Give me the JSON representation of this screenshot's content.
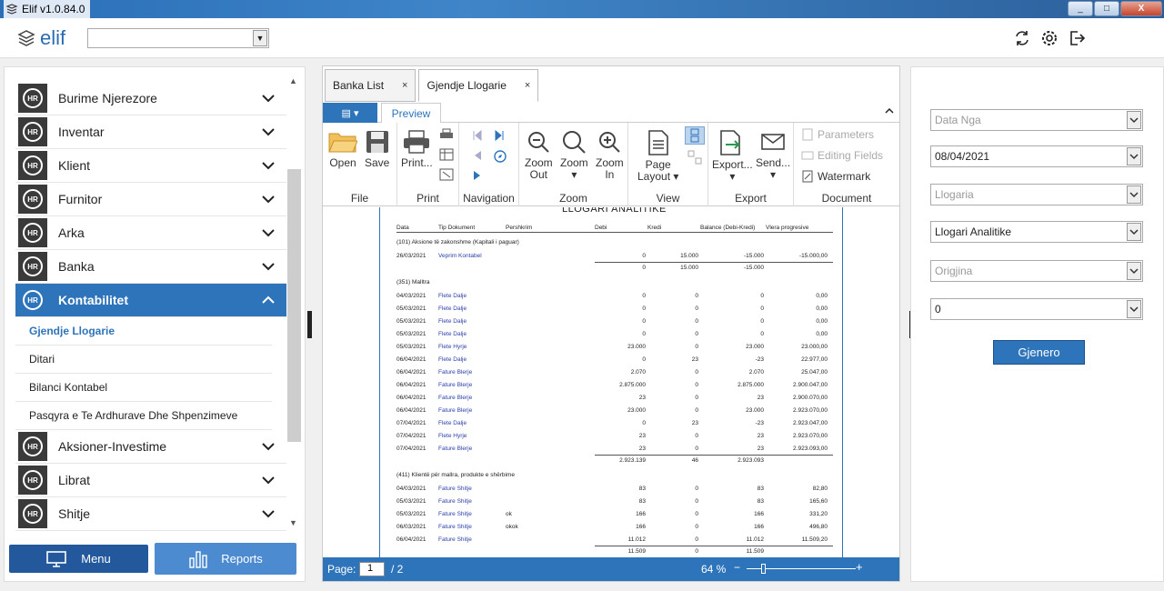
{
  "window": {
    "title": "Elif v1.0.84.0",
    "controls": [
      "_",
      "□",
      "X"
    ]
  },
  "app": {
    "logo_text": "elif",
    "top_combo_value": ""
  },
  "sidebar": {
    "items_before": [
      {
        "label": "Burime Njerezore"
      },
      {
        "label": "Inventar"
      },
      {
        "label": "Klient"
      },
      {
        "label": "Furnitor"
      },
      {
        "label": "Arka"
      },
      {
        "label": "Banka"
      }
    ],
    "active": {
      "label": "Kontabilitet"
    },
    "subitems": [
      {
        "label": "Gjendje Llogarie",
        "selected": true
      },
      {
        "label": "Ditari"
      },
      {
        "label": "Bilanci Kontabel"
      },
      {
        "label": "Pasqyra e Te Ardhurave Dhe Shpenzimeve"
      }
    ],
    "items_after": [
      {
        "label": "Aksioner-Investime"
      },
      {
        "label": "Librat"
      },
      {
        "label": "Shitje"
      }
    ],
    "hr_badge": "HR",
    "menu_button": "Menu",
    "reports_button": "Reports"
  },
  "tabs": [
    {
      "label": "Banka List",
      "close": "×"
    },
    {
      "label": "Gjendje Llogarie",
      "close": "×"
    }
  ],
  "ribbon": {
    "preview_tab": "Preview",
    "file_tab_icon": "▤ ▾",
    "groups": {
      "file": "File",
      "print": "Print",
      "navigation": "Navigation",
      "zoom": "Zoom",
      "view": "View",
      "export": "Export",
      "document": "Document"
    },
    "buttons": {
      "open": "Open",
      "save": "Save",
      "print": "Print...",
      "zoom_out": [
        "Zoom",
        "Out"
      ],
      "zoom": [
        "Zoom",
        "▾"
      ],
      "zoom_in": [
        "Zoom",
        "In"
      ],
      "page_layout": [
        "Page",
        "Layout ▾"
      ],
      "export": [
        "Export...",
        "▾"
      ],
      "send": [
        "Send...",
        "▾"
      ],
      "parameters": "Parameters",
      "editing_fields": "Editing Fields",
      "watermark": "Watermark"
    }
  },
  "report": {
    "title": "LLOGARI ANALITIKE",
    "columns": [
      "Data",
      "Tip Dokument",
      "Pershkrim",
      "Debi",
      "Kredi",
      "Balance (Debi-Kredi)",
      "Vlera progresive"
    ],
    "groups": [
      {
        "name": "(101) Aksione të zakonshme (Kapitali i paguar)",
        "rows": [
          [
            "26/03/2021",
            "Veprim Kontabel",
            "",
            "0",
            "15.000",
            "-15.000",
            "-15.000,00"
          ]
        ],
        "total": [
          "0",
          "15.000",
          "-15.000"
        ]
      },
      {
        "name": "(351) Malltra",
        "rows": [
          [
            "04/03/2021",
            "Flete Dalje",
            "",
            "0",
            "0",
            "0",
            "0,00"
          ],
          [
            "05/03/2021",
            "Flete Dalje",
            "",
            "0",
            "0",
            "0",
            "0,00"
          ],
          [
            "05/03/2021",
            "Flete Dalje",
            "",
            "0",
            "0",
            "0",
            "0,00"
          ],
          [
            "05/03/2021",
            "Flete Dalje",
            "",
            "0",
            "0",
            "0",
            "0,00"
          ],
          [
            "05/03/2021",
            "Flete Hyrje",
            "",
            "23.000",
            "0",
            "23.000",
            "23.000,00"
          ],
          [
            "06/04/2021",
            "Flete Dalje",
            "",
            "0",
            "23",
            "-23",
            "22.977,00"
          ],
          [
            "06/04/2021",
            "Fature Blerje",
            "",
            "2.070",
            "0",
            "2.070",
            "25.047,00"
          ],
          [
            "06/04/2021",
            "Fature Blerje",
            "",
            "2.875.000",
            "0",
            "2.875.000",
            "2.900.047,00"
          ],
          [
            "06/04/2021",
            "Fature Blerje",
            "",
            "23",
            "0",
            "23",
            "2.900.070,00"
          ],
          [
            "06/04/2021",
            "Fature Blerje",
            "",
            "23.000",
            "0",
            "23.000",
            "2.923.070,00"
          ],
          [
            "07/04/2021",
            "Flete Dalje",
            "",
            "0",
            "23",
            "-23",
            "2.923.047,00"
          ],
          [
            "07/04/2021",
            "Flete Hyrje",
            "",
            "23",
            "0",
            "23",
            "2.923.070,00"
          ],
          [
            "07/04/2021",
            "Fature Blerje",
            "",
            "23",
            "0",
            "23",
            "2.923.093,00"
          ]
        ],
        "total": [
          "2.923.139",
          "46",
          "2.923.093"
        ]
      },
      {
        "name": "(411) Klientë për mallra, produkte e shërbime",
        "rows": [
          [
            "04/03/2021",
            "Fature Shitje",
            "",
            "83",
            "0",
            "83",
            "82,80"
          ],
          [
            "05/03/2021",
            "Fature Shitje",
            "",
            "83",
            "0",
            "83",
            "165,60"
          ],
          [
            "05/03/2021",
            "Fature Shitje",
            "ok",
            "166",
            "0",
            "166",
            "331,20"
          ],
          [
            "06/03/2021",
            "Fature Shitje",
            "okok",
            "166",
            "0",
            "166",
            "496,80"
          ],
          [
            "06/04/2021",
            "Fature Shitje",
            "",
            "11.012",
            "0",
            "11.012",
            "11.509,20"
          ]
        ],
        "total": [
          "11.509",
          "0",
          "11.509"
        ]
      }
    ]
  },
  "status": {
    "page_label": "Page:",
    "page_value": "1",
    "page_of": "/ 2",
    "zoom": "64 %",
    "zoom_level_percent": 64
  },
  "filters": {
    "data_nga": {
      "placeholder": "Data Nga",
      "value": ""
    },
    "date": {
      "value": "08/04/2021"
    },
    "llogaria": {
      "placeholder": "Llogaria",
      "value": ""
    },
    "type": {
      "value": "Llogari Analitike"
    },
    "origjina": {
      "placeholder": "Origjina",
      "value": ""
    },
    "number": {
      "value": "0"
    },
    "generate_button": "Gjenero"
  }
}
